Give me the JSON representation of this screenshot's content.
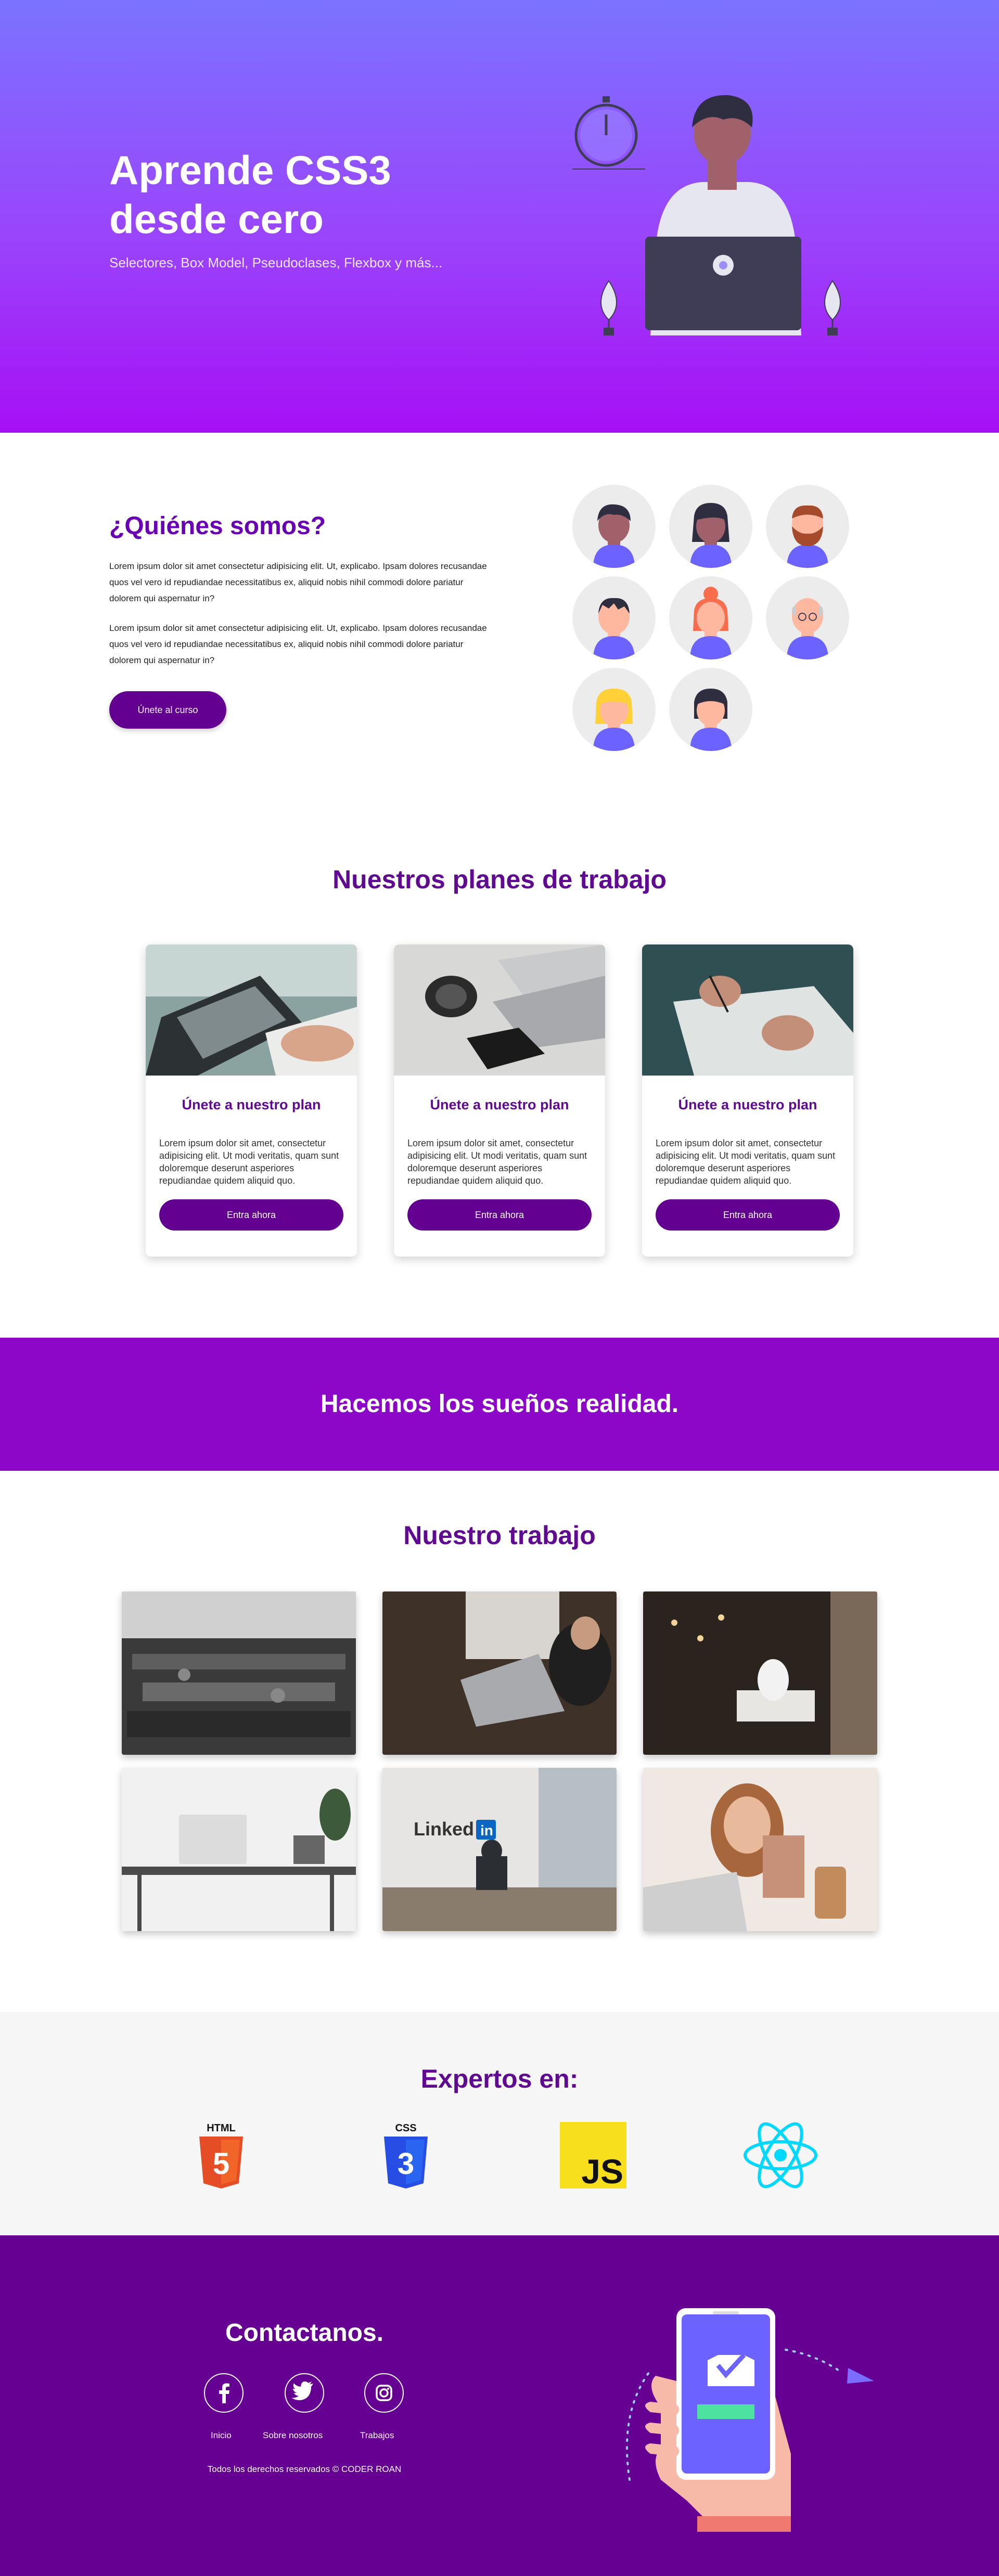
{
  "hero": {
    "title": "Aprende CSS3 desde cero",
    "subtitle": "Selectores, Box Model, Pseudoclases, Flexbox y más..."
  },
  "about": {
    "title": "¿Quiénes somos?",
    "paragraphs": [
      "Lorem ipsum dolor sit amet consectetur adipisicing elit. Ut, explicabo. Ipsam dolores recusandae quos vel vero id repudiandae necessitatibus ex, aliquid nobis nihil commodi dolore pariatur dolorem qui aspernatur in?",
      "Lorem ipsum dolor sit amet consectetur adipisicing elit. Ut, explicabo. Ipsam dolores recusandae quos vel vero id repudiandae necessitatibus ex, aliquid nobis nihil commodi dolore pariatur dolorem qui aspernatur in?"
    ],
    "button": "Únete al curso"
  },
  "plans": {
    "title": "Nuestros planes de trabajo",
    "cards": [
      {
        "title": "Únete a nuestro plan",
        "text": "Lorem ipsum dolor sit amet, consectetur adipisicing elit. Ut modi veritatis, quam sunt doloremque deserunt asperiores repudiandae quidem aliquid quo.",
        "button": "Entra ahora"
      },
      {
        "title": "Únete a nuestro plan",
        "text": "Lorem ipsum dolor sit amet, consectetur adipisicing elit. Ut modi veritatis, quam sunt doloremque deserunt asperiores repudiandae quidem aliquid quo.",
        "button": "Entra ahora"
      },
      {
        "title": "Únete a nuestro plan",
        "text": "Lorem ipsum dolor sit amet, consectetur adipisicing elit. Ut modi veritatis, quam sunt doloremque deserunt asperiores repudiandae quidem aliquid quo.",
        "button": "Entra ahora"
      }
    ]
  },
  "banner": {
    "text": "Hacemos los sueños realidad."
  },
  "work": {
    "title": "Nuestro trabajo",
    "linkedin": "Linked"
  },
  "experts": {
    "title": "Expertos en:",
    "tech": [
      {
        "name": "html5-logo",
        "label": "HTML",
        "glyph": "5",
        "color": "#e44d26"
      },
      {
        "name": "css3-logo",
        "label": "CSS",
        "glyph": "3",
        "color": "#2965f1"
      },
      {
        "name": "javascript-logo",
        "label": "JS",
        "color": "#f7df1e"
      },
      {
        "name": "react-logo",
        "color": "#00d8ff"
      }
    ]
  },
  "contact": {
    "title": "Contactanos.",
    "social": [
      "facebook-icon",
      "twitter-icon",
      "instagram-icon"
    ],
    "links": [
      "Inicio",
      "Sobre nosotros",
      "Trabajos"
    ],
    "copyright": "Todos los derechos reservados © CODER ROAN"
  },
  "colors": {
    "primary": "#630092",
    "accent": "#9a44fb",
    "banner": "#8d07c9"
  }
}
